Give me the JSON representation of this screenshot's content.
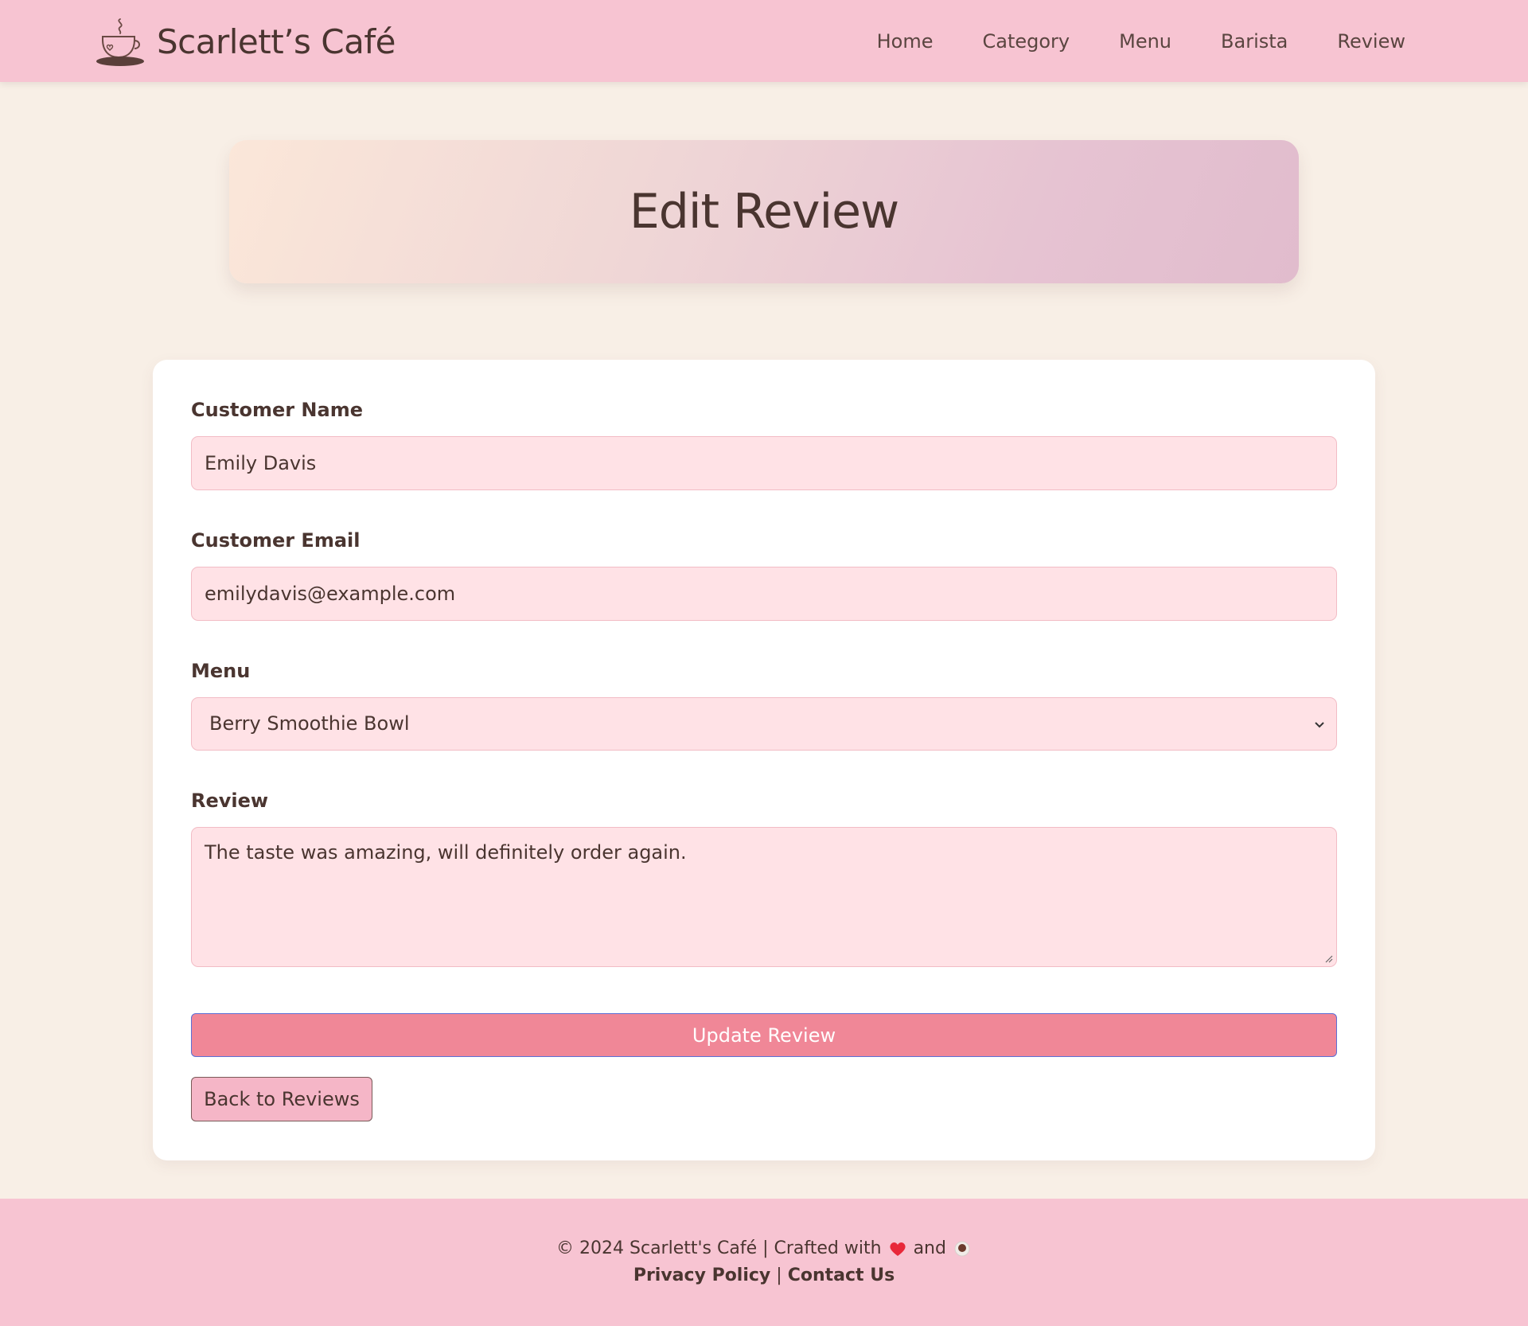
{
  "brand": {
    "name": "Scarlett’s Café",
    "logo_icon": "coffee-cup-icon"
  },
  "nav": {
    "items": [
      {
        "label": "Home"
      },
      {
        "label": "Category"
      },
      {
        "label": "Menu"
      },
      {
        "label": "Barista"
      },
      {
        "label": "Review"
      }
    ]
  },
  "hero": {
    "title": "Edit Review"
  },
  "form": {
    "customer_name": {
      "label": "Customer Name",
      "value": "Emily Davis"
    },
    "customer_email": {
      "label": "Customer Email",
      "value": "emilydavis@example.com"
    },
    "menu": {
      "label": "Menu",
      "selected": "Berry Smoothie Bowl"
    },
    "review": {
      "label": "Review",
      "value": "The taste was amazing, will definitely order again."
    },
    "update_button": "Update Review",
    "back_button": "Back to Reviews"
  },
  "footer": {
    "copyright": "© 2024 Scarlett's Café | Crafted with",
    "and": "and",
    "privacy": "Privacy Policy",
    "separator": "|",
    "contact": "Contact Us"
  },
  "colors": {
    "nav_bg": "#f7c4d2",
    "page_bg": "#f8efe6",
    "field_bg": "#ffe2e6",
    "primary_button": "#f08797",
    "text": "#4a3530"
  }
}
